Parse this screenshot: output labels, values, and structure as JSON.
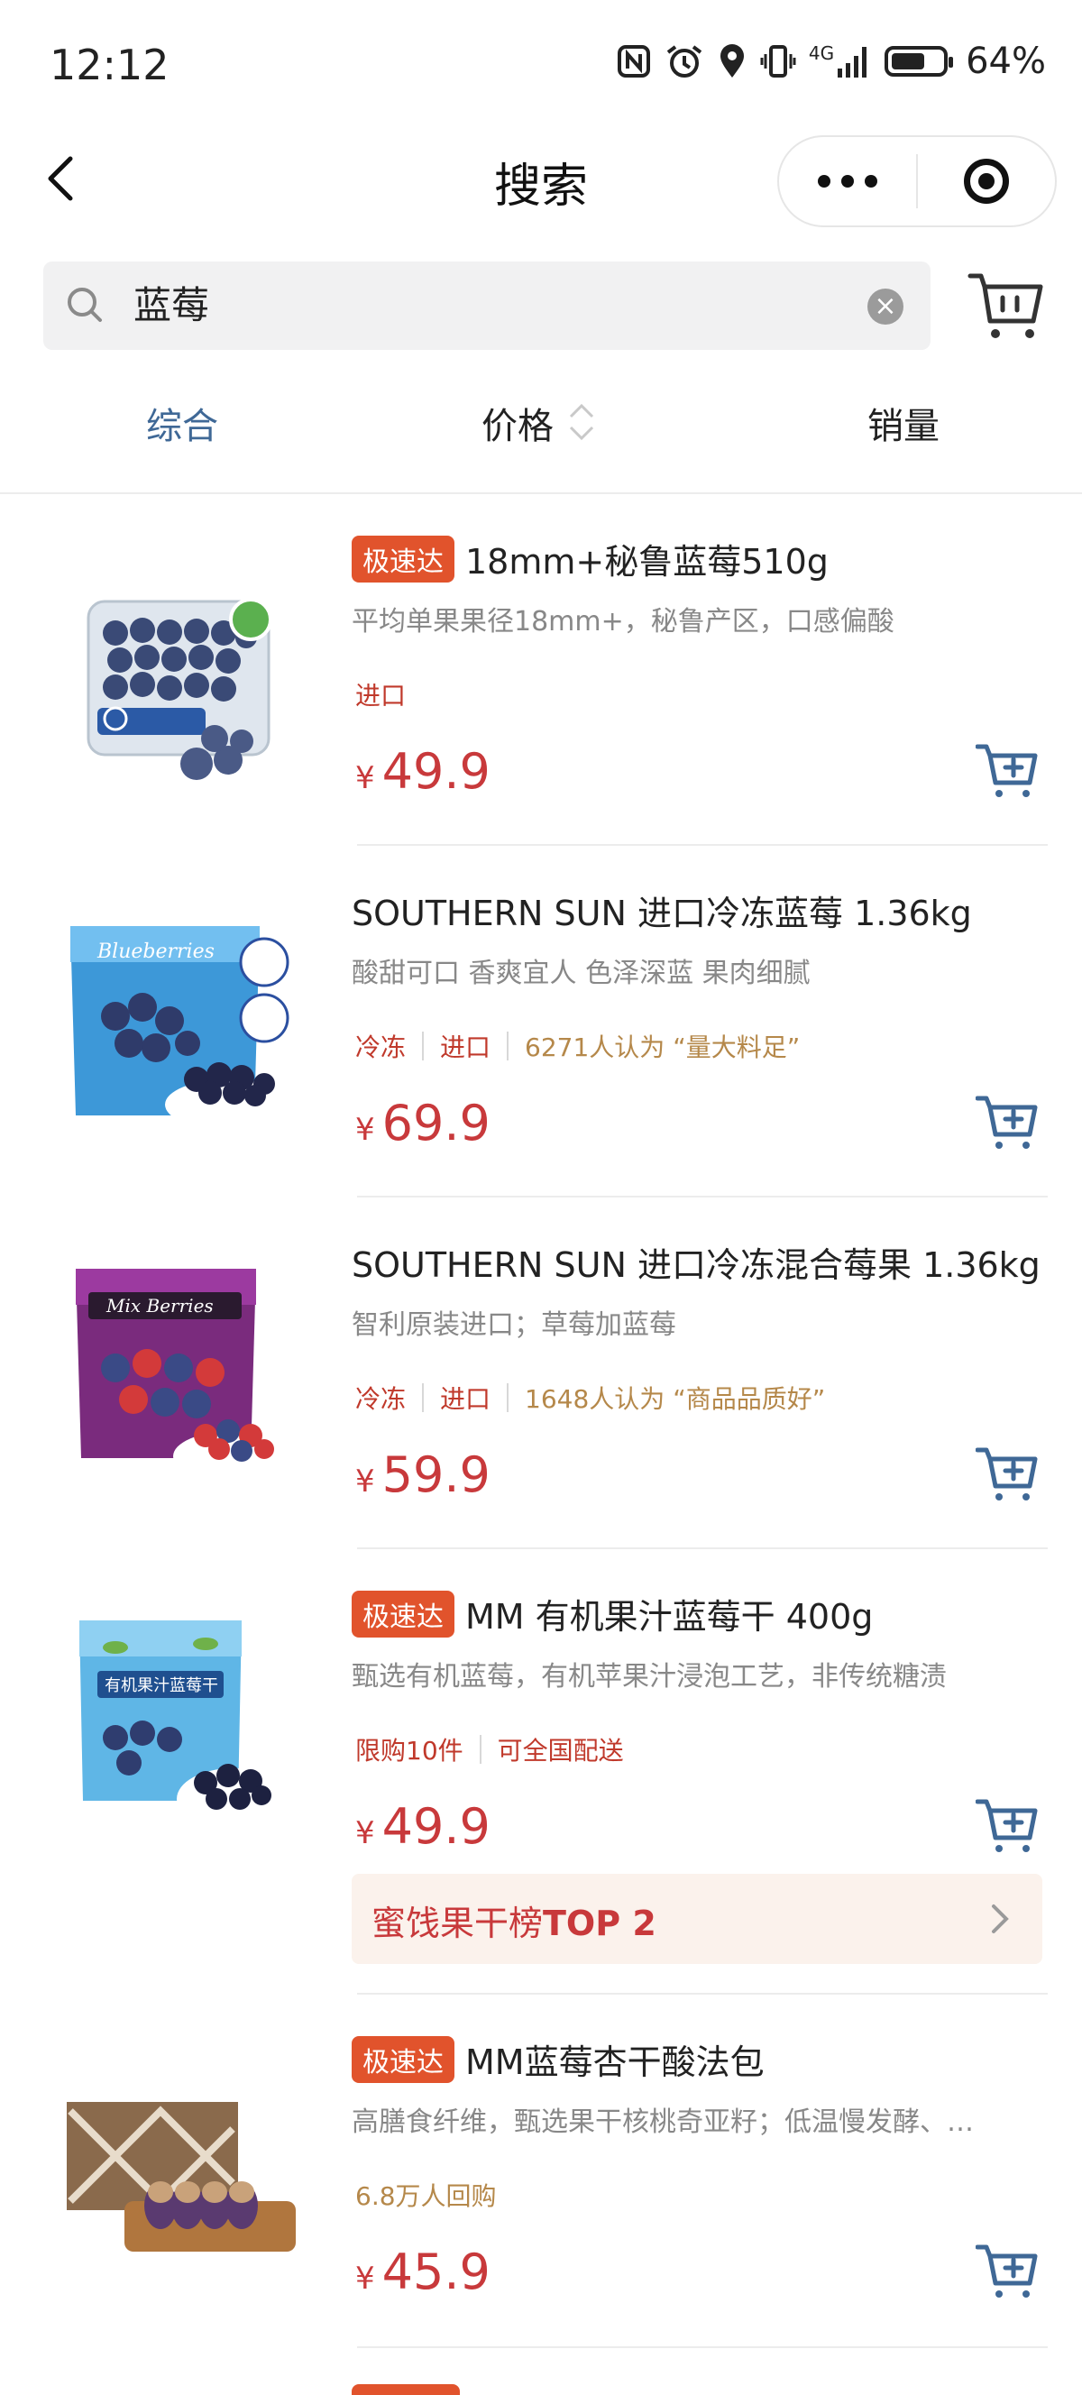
{
  "status_bar": {
    "time": "12:12",
    "battery_percent": "64%",
    "network": "4G",
    "icons": [
      "nfc-icon",
      "alarm-icon",
      "location-icon",
      "vibrate-icon",
      "signal-icon",
      "battery-icon"
    ]
  },
  "nav": {
    "title": "搜索"
  },
  "search": {
    "query": "蓝莓",
    "clear_glyph": "×"
  },
  "tabs": [
    {
      "label": "综合",
      "active": true
    },
    {
      "label": "价格",
      "active": false
    },
    {
      "label": "销量",
      "active": false
    }
  ],
  "colors": {
    "accent": "#3f6896",
    "price": "#c8393b",
    "badge": "#e1532c",
    "tag_gold": "#b5884a"
  },
  "products": [
    {
      "badge": "极速达",
      "name": "18mm+秘鲁蓝莓510g",
      "desc": "平均单果果径18mm+，秘鲁产区，口感偏酸",
      "tags": [
        "进口"
      ],
      "currency": "¥",
      "price": "49.9"
    },
    {
      "badge": "",
      "name": "SOUTHERN SUN 进口冷冻蓝莓 1.36kg",
      "desc": "酸甜可口 香爽宜人 色泽深蓝 果肉细腻",
      "tags": [
        "冷冻",
        "进口"
      ],
      "gold_tag": "6271人认为 “量大料足”",
      "currency": "¥",
      "price": "69.9"
    },
    {
      "badge": "",
      "name": "SOUTHERN SUN 进口冷冻混合莓果 1.36kg",
      "desc": "智利原装进口；草莓加蓝莓",
      "tags": [
        "冷冻",
        "进口"
      ],
      "gold_tag": "1648人认为 “商品品质好”",
      "currency": "¥",
      "price": "59.9"
    },
    {
      "badge": "极速达",
      "name": "MM 有机果汁蓝莓干 400g",
      "desc": "甄选有机蓝莓，有机苹果汁浸泡工艺，非传统糖渍",
      "tags": [
        "限购10件",
        "可全国配送"
      ],
      "currency": "¥",
      "price": "49.9",
      "rank_prefix": "蜜饯果干榜",
      "rank_top": "TOP 2"
    },
    {
      "badge": "极速达",
      "name": "MM蓝莓杏干酸法包",
      "desc": "高膳食纤维，甄选果干核桃奇亚籽；低温慢发酵、…",
      "gold_tag": "6.8万人回购",
      "currency": "¥",
      "price": "45.9"
    }
  ]
}
